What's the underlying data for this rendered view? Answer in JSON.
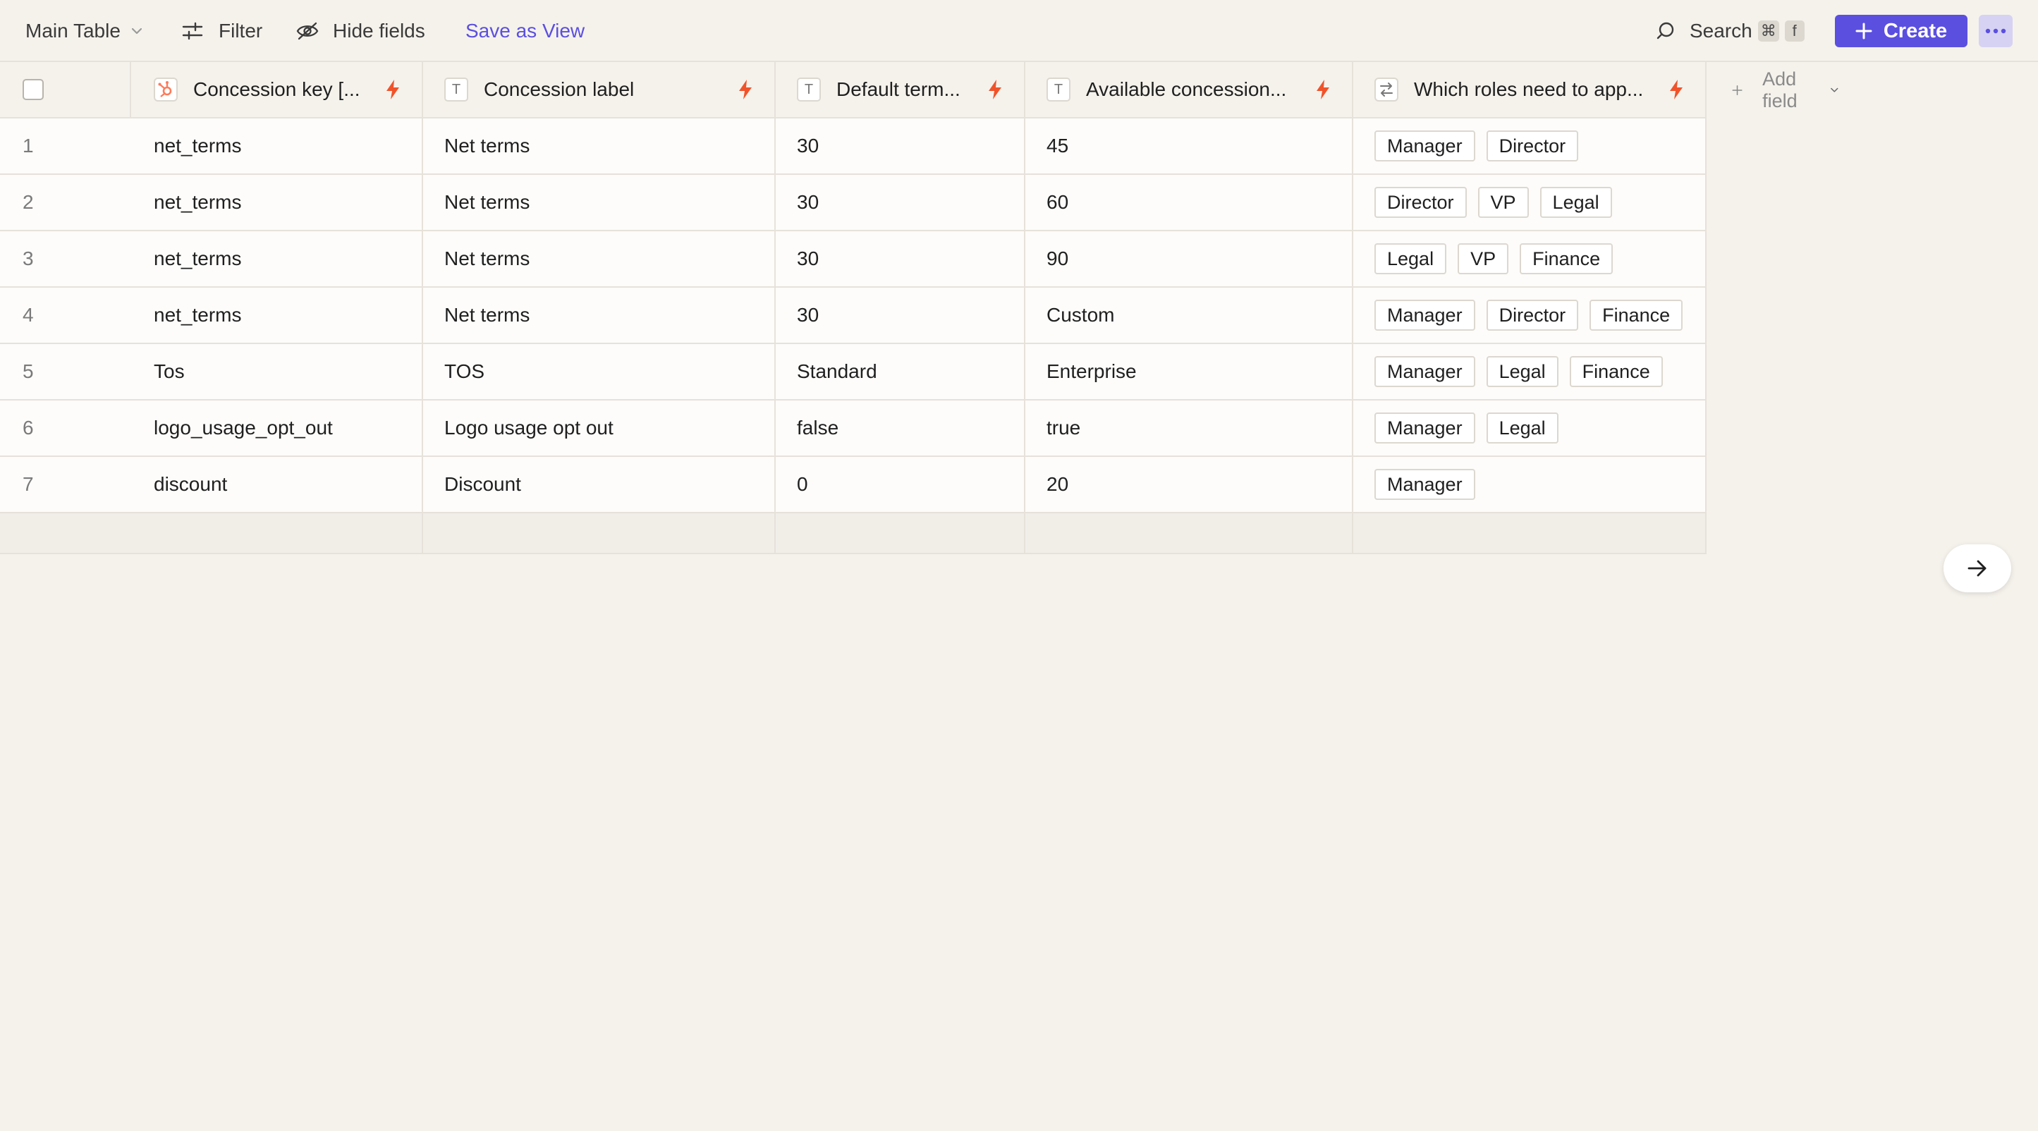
{
  "toolbar": {
    "view_name": "Main Table",
    "filter_label": "Filter",
    "hide_fields_label": "Hide fields",
    "save_view_label": "Save as View",
    "search_label": "Search",
    "search_shortcut": [
      "⌘",
      "f"
    ],
    "create_label": "Create"
  },
  "columns": [
    {
      "label": "Concession key [...",
      "type_icon": "hubspot-icon"
    },
    {
      "label": "Concession label",
      "type_icon": "text-type-icon"
    },
    {
      "label": "Default term...",
      "type_icon": "text-type-icon"
    },
    {
      "label": "Available concession...",
      "type_icon": "text-type-icon"
    },
    {
      "label": "Which roles need to app...",
      "type_icon": "multi-select-icon"
    }
  ],
  "add_field_label": "Add field",
  "rows": [
    {
      "num": "1",
      "key": "net_terms",
      "label": "Net terms",
      "default": "30",
      "available": "45",
      "roles": [
        "Manager",
        "Director"
      ]
    },
    {
      "num": "2",
      "key": "net_terms",
      "label": "Net terms",
      "default": "30",
      "available": "60",
      "roles": [
        "Director",
        "VP",
        "Legal"
      ]
    },
    {
      "num": "3",
      "key": "net_terms",
      "label": "Net terms",
      "default": "30",
      "available": "90",
      "roles": [
        "Legal",
        "VP",
        "Finance"
      ]
    },
    {
      "num": "4",
      "key": "net_terms",
      "label": "Net terms",
      "default": "30",
      "available": "Custom",
      "roles": [
        "Manager",
        "Director",
        "Finance"
      ]
    },
    {
      "num": "5",
      "key": "Tos",
      "label": "TOS",
      "default": "Standard",
      "available": "Enterprise",
      "roles": [
        "Manager",
        "Legal",
        "Finance"
      ]
    },
    {
      "num": "6",
      "key": "logo_usage_opt_out",
      "label": "Logo usage opt out",
      "default": "false",
      "available": "true",
      "roles": [
        "Manager",
        "Legal"
      ]
    },
    {
      "num": "7",
      "key": "discount",
      "label": "Discount",
      "default": "0",
      "available": "20",
      "roles": [
        "Manager"
      ]
    }
  ],
  "colors": {
    "accent": "#5b4fe0",
    "bolt": "#f0532a",
    "hubspot": "#ff7a59"
  }
}
